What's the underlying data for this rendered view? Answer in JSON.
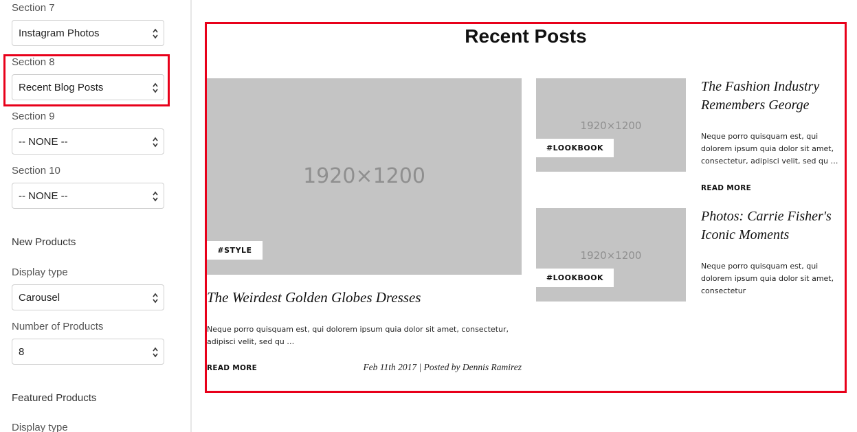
{
  "sidebar": {
    "fields": [
      {
        "label": "Section 7",
        "value": "Instagram Photos"
      },
      {
        "label": "Section 8",
        "value": "Recent Blog Posts"
      },
      {
        "label": "Section 9",
        "value": "-- NONE --"
      },
      {
        "label": "Section 10",
        "value": "-- NONE --"
      }
    ],
    "new_products": {
      "heading": "New Products",
      "display_type_label": "Display type",
      "display_type_value": "Carousel",
      "number_label": "Number of Products",
      "number_value": "8"
    },
    "featured_products": {
      "heading": "Featured Products",
      "display_type_label": "Display type"
    }
  },
  "main": {
    "title": "Recent Posts",
    "featured_post": {
      "image_dims": "1920×1200",
      "tag": "#STYLE",
      "title": "The Weirdest Golden Globes Dresses",
      "excerpt": "Neque porro quisquam est, qui dolorem ipsum quia dolor sit amet, consectetur, adipisci velit, sed qu …",
      "read_more": "READ MORE",
      "meta": "Feb 11th 2017 | Posted by Dennis Ramirez"
    },
    "side_posts": [
      {
        "image_dims": "1920×1200",
        "tag": "#LOOKBOOK",
        "title_line1": "The Fashion Industry",
        "title_line2": "Remembers George",
        "excerpt": "Neque porro quisquam est, qui dolorem ipsum quia dolor sit amet, consectetur, adipisci velit, sed qu …",
        "read_more": "READ MORE"
      },
      {
        "image_dims": "1920×1200",
        "tag": "#LOOKBOOK",
        "title_line1": "Photos: Carrie Fisher's",
        "title_line2": "Iconic Moments",
        "excerpt": "Neque porro quisquam est, qui dolorem ipsum quia dolor sit amet, consectetur"
      }
    ]
  },
  "colors": {
    "highlight": "#e8001a",
    "placeholder": "#c4c4c4"
  }
}
